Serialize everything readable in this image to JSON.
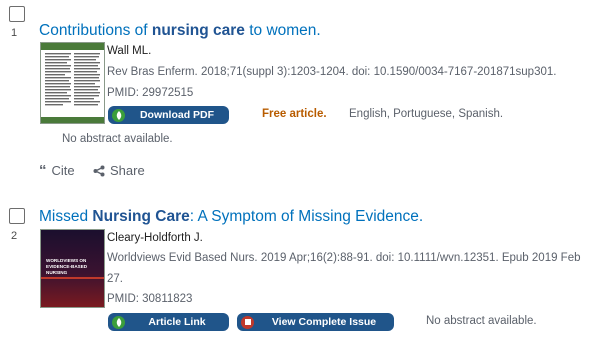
{
  "results": [
    {
      "number": "1",
      "title_pre": "Contributions of ",
      "title_bold": "nursing care",
      "title_post": " to women.",
      "authors": "Wall ML.",
      "citation": "Rev Bras Enferm. 2018;71(suppl 3):1203-1204. doi: 10.1590/0034-7167-201871sup301.",
      "pmid": "PMID: 29972515",
      "button_label": "Download PDF",
      "free_label": "Free article.",
      "languages": "English, Portuguese, Spanish.",
      "no_abstract": "No abstract available.",
      "cite_label": "Cite",
      "share_label": "Share"
    },
    {
      "number": "2",
      "title_pre": "Missed ",
      "title_bold": "Nursing Care",
      "title_post": ": A Symptom of Missing Evidence.",
      "authors": "Cleary-Holdforth J.",
      "citation_line1": "Worldviews Evid Based Nurs. 2019 Apr;16(2):88-91. doi: 10.1111/wvn.12351. Epub 2019 Feb",
      "citation_line2": "27.",
      "pmid": "PMID: 30811823",
      "button1_label": "Article Link",
      "button2_label": "View Complete Issue",
      "no_abstract": "No abstract available.",
      "cover_text_1": "WORLDVIEWS ON",
      "cover_text_2": "EVIDENCE-BASED NURSING"
    }
  ],
  "colors": {
    "link": "#0071bc",
    "button": "#20558a",
    "free": "#b85c00"
  }
}
